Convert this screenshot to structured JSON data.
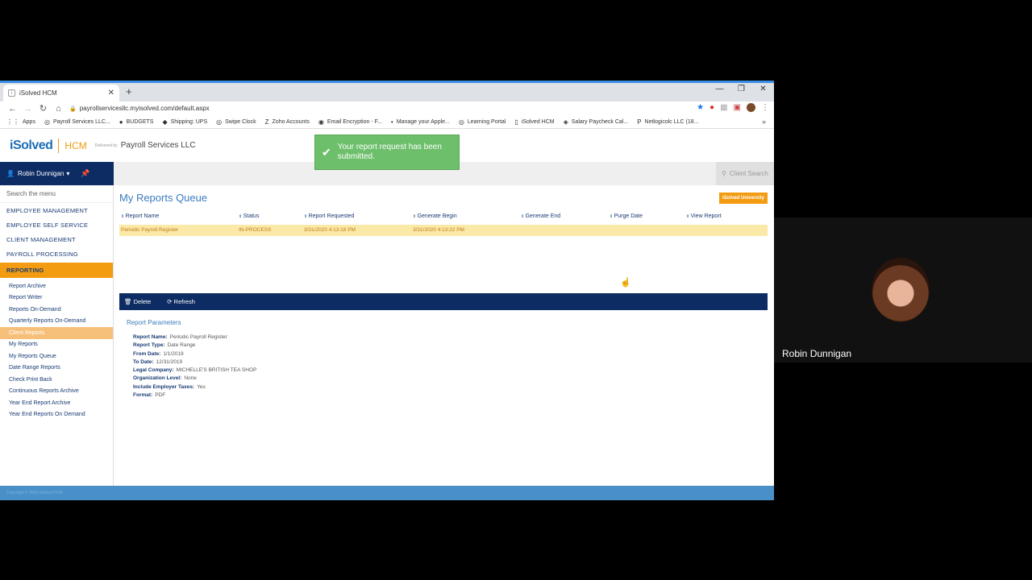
{
  "browser": {
    "tab_title": "iSolved HCM",
    "url": "payrollservicesllc.myisolved.com/default.aspx",
    "bookmarks": [
      {
        "icon": "grid-icon",
        "label": "Apps"
      },
      {
        "icon": "globe-icon",
        "label": "Payroll Services LLC..."
      },
      {
        "icon": "budget-icon",
        "label": "BUDGETS"
      },
      {
        "icon": "ups-icon",
        "label": "Shipping: UPS"
      },
      {
        "icon": "globe-icon",
        "label": "Swipe Clock"
      },
      {
        "icon": "zoho-icon",
        "label": "Zoho Accounts"
      },
      {
        "icon": "mail-icon",
        "label": "Email Encryption - F..."
      },
      {
        "icon": "apple-icon",
        "label": "Manage your Apple..."
      },
      {
        "icon": "globe-icon",
        "label": "Learning Portal"
      },
      {
        "icon": "page-icon",
        "label": "iSolved HCM"
      },
      {
        "icon": "paycheck-icon",
        "label": "Salary Paycheck Cal..."
      },
      {
        "icon": "p-icon",
        "label": "Netlogicolc LLC (18..."
      }
    ]
  },
  "header": {
    "logo_main": "iSolved",
    "logo_hcm": "HCM",
    "delivered_by": "Delivered by",
    "company": "Payroll Services LLC"
  },
  "toast": {
    "message": "Your report request has been submitted."
  },
  "topnav": {
    "user": "Robin Dunnigan",
    "client_search": "Client Search"
  },
  "sidebar": {
    "search_placeholder": "Search the menu",
    "sections": [
      "EMPLOYEE MANAGEMENT",
      "EMPLOYEE SELF SERVICE",
      "CLIENT MANAGEMENT",
      "PAYROLL PROCESSING"
    ],
    "active_section": "REPORTING",
    "items": [
      "Report Archive",
      "Report Writer",
      "Reports On-Demand",
      "Quarterly Reports On-Demand",
      "Client Reports",
      "My Reports",
      "My Reports Queue",
      "Date Range Reports",
      "Check Print Back",
      "Continuous Reports Archive",
      "Year End Report Archive",
      "Year End Reports On Demand"
    ]
  },
  "main": {
    "title": "My Reports Queue",
    "university_label": "iSolved University",
    "columns": [
      "Report Name",
      "Status",
      "Report Requested",
      "Generate Begin",
      "Generate End",
      "Purge Date",
      "View Report"
    ],
    "row": {
      "report_name": "Periodic Payroll Register",
      "status": "IN-PROCESS",
      "report_requested": "3/31/2020 4:13:18 PM",
      "generate_begin": "3/31/2020 4:13:22 PM",
      "generate_end": "",
      "purge_date": "",
      "view_report": ""
    },
    "toolbar": {
      "delete_label": "Delete",
      "refresh_label": "Refresh"
    },
    "params_title": "Report Parameters",
    "params": [
      {
        "k": "Report Name:",
        "v": "Periodic Payroll Register"
      },
      {
        "k": "Report Type:",
        "v": "Date Range"
      },
      {
        "k": "From Date:",
        "v": "1/1/2019"
      },
      {
        "k": "To Date:",
        "v": "12/31/2019"
      },
      {
        "k": "Legal Company:",
        "v": "MICHELLE'S BRITISH TEA SHOP"
      },
      {
        "k": "Organization Level:",
        "v": "None"
      },
      {
        "k": "Include Employer Taxes:",
        "v": "Yes"
      },
      {
        "k": "Format:",
        "v": "PDF"
      }
    ]
  },
  "footer": {
    "copyright": "Copyright © 2020 iSolved HCM"
  },
  "webcam": {
    "name": "Robin Dunnigan"
  }
}
